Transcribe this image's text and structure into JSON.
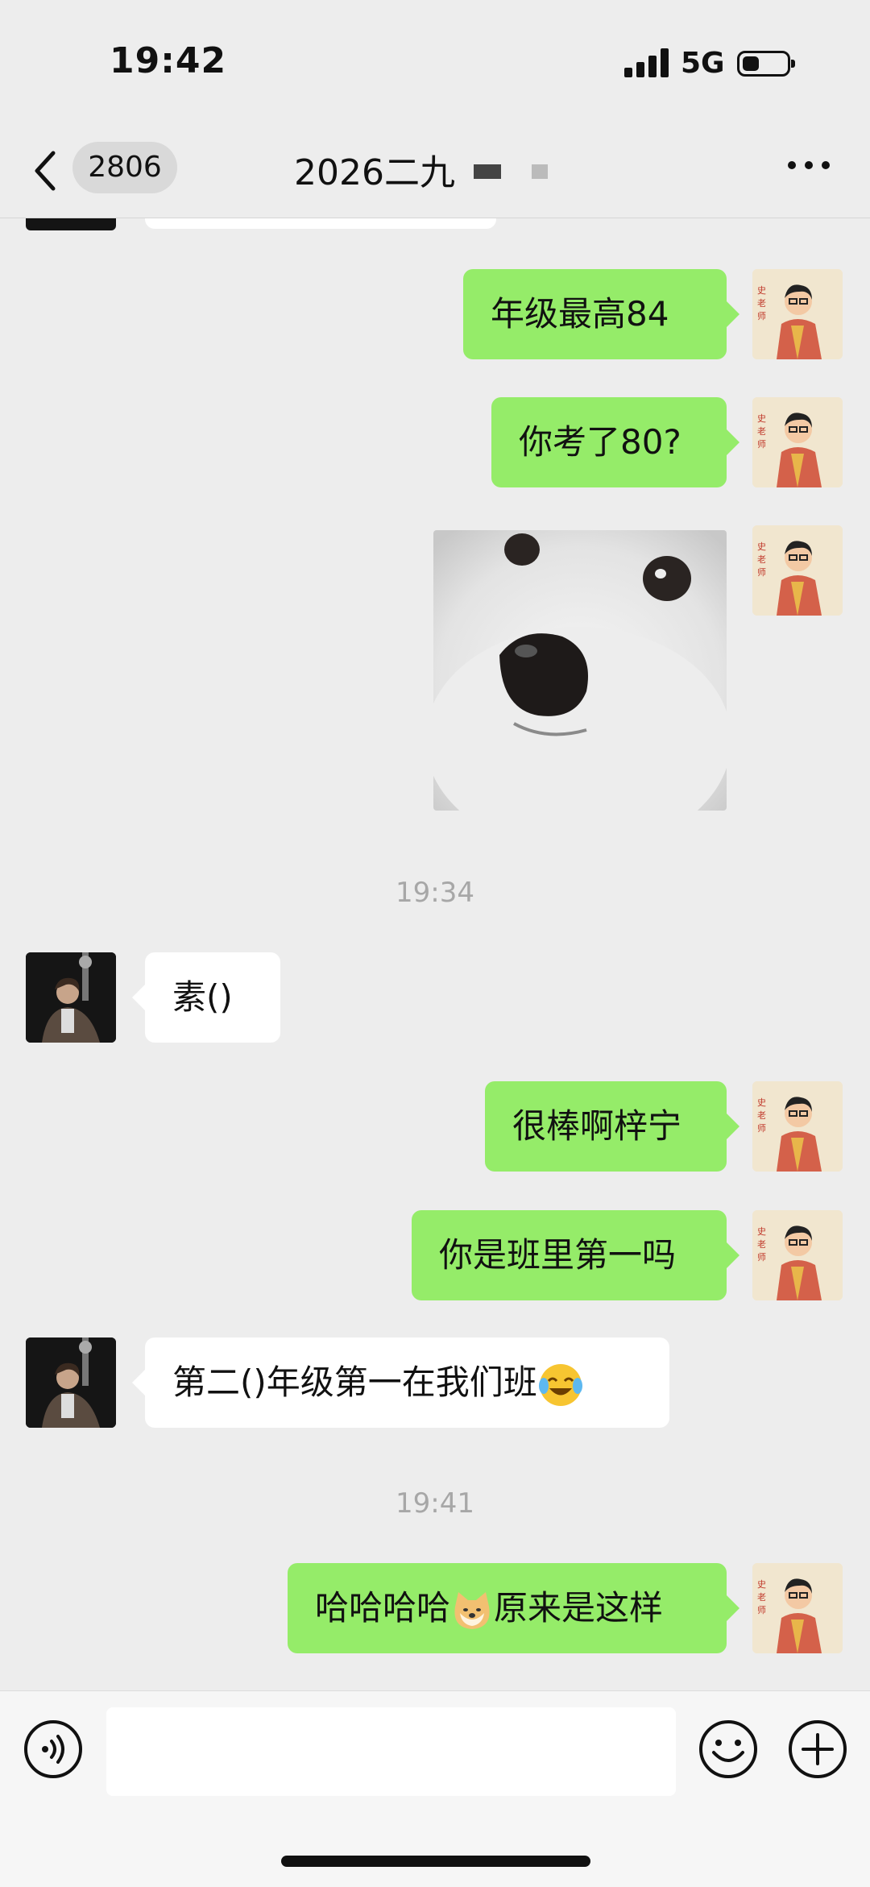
{
  "status_bar": {
    "time": "19:42",
    "network": "5G"
  },
  "header": {
    "unread_count": "2806",
    "title": "2026二九"
  },
  "messages": [
    {
      "from": "me",
      "text": "年级最高84"
    },
    {
      "from": "me",
      "text": "你考了80?"
    },
    {
      "from": "me",
      "type": "image",
      "image": "white-puppy-meme"
    },
    {
      "type": "time",
      "text": "19:34"
    },
    {
      "from": "other",
      "text": "素()"
    },
    {
      "from": "me",
      "text": "很棒啊梓宁"
    },
    {
      "from": "me",
      "text": "你是班里第一吗"
    },
    {
      "from": "other",
      "text": "第二()年级第一在我们班",
      "emoji": "crying-laughing-emoji"
    },
    {
      "type": "time",
      "text": "19:41"
    },
    {
      "from": "me",
      "text_before": "哈哈哈哈",
      "emoji": "doge-emoji",
      "text_after": "原来是这样"
    }
  ],
  "input_bar": {
    "text_value": "",
    "icons": [
      "voice-icon",
      "emoji-icon",
      "plus-icon"
    ]
  },
  "colors": {
    "background": "#ededed",
    "my_bubble": "#95ec69",
    "other_bubble": "#ffffff"
  }
}
